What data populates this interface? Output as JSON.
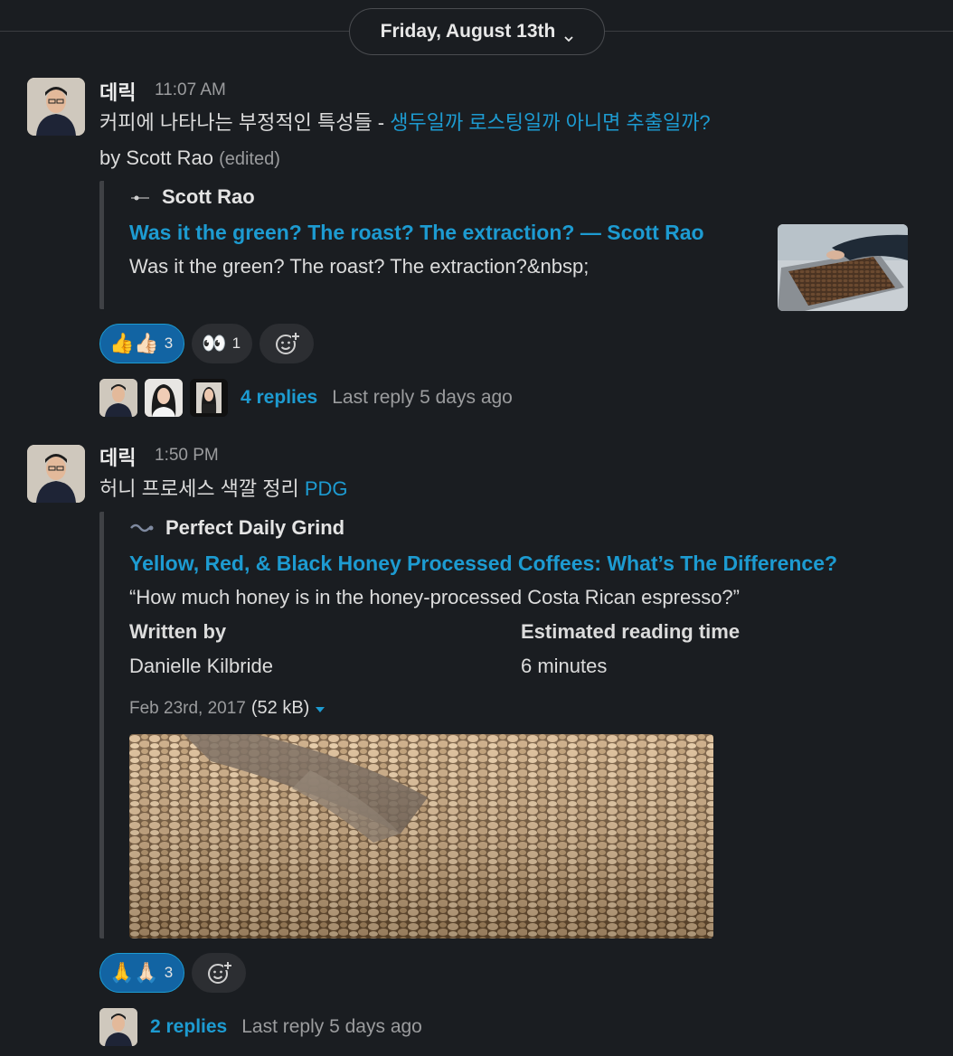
{
  "date_divider": {
    "label": "Friday, August 13th"
  },
  "messages": [
    {
      "sender": "데릭",
      "time": "11:07 AM",
      "text_plain": "커피에 나타나는 부정적인 특성들 - ",
      "text_link": "생두일까 로스팅일까 아니면 추출일까?",
      "text_line2": "by Scott Rao",
      "edited": "(edited)",
      "attachment": {
        "service_name": "Scott Rao",
        "title": "Was it the green? The roast? The extraction?  — Scott Rao",
        "description": "Was it the green? The roast? The extraction?&nbsp;"
      },
      "reactions": [
        {
          "emoji": "👍👍🏻",
          "count": "3",
          "active": true
        },
        {
          "emoji": "👀",
          "count": "1",
          "active": false
        }
      ],
      "thread": {
        "replies": "4 replies",
        "last_reply": "Last reply 5 days ago"
      }
    },
    {
      "sender": "데릭",
      "time": "1:50 PM",
      "text_plain": "허니 프로세스 색깔 정리 ",
      "text_link": "PDG",
      "attachment": {
        "service_name": "Perfect Daily Grind",
        "title": "Yellow, Red, & Black Honey Processed Coffees: What’s The Difference?",
        "description": "“How much honey is in the honey-processed Costa Rican espresso?”",
        "fields": [
          {
            "title": "Written by",
            "value": "Danielle Kilbride"
          },
          {
            "title": "Estimated reading time",
            "value": "6 minutes"
          }
        ],
        "file_date": "Feb 23rd, 2017",
        "file_size": "(52 kB)"
      },
      "reactions": [
        {
          "emoji": "🙏🙏🏻",
          "count": "3",
          "active": true
        }
      ],
      "thread": {
        "replies": "2 replies",
        "last_reply": "Last reply 5 days ago"
      }
    }
  ],
  "icons": {
    "chevron": "chevron-down-icon",
    "add_reaction": "add-reaction-icon",
    "file_menu": "caret-down-icon"
  },
  "colors": {
    "background": "#1a1d21",
    "link": "#1d9bd1",
    "reaction_active": "#1264a3",
    "muted": "#9b9c9e"
  }
}
